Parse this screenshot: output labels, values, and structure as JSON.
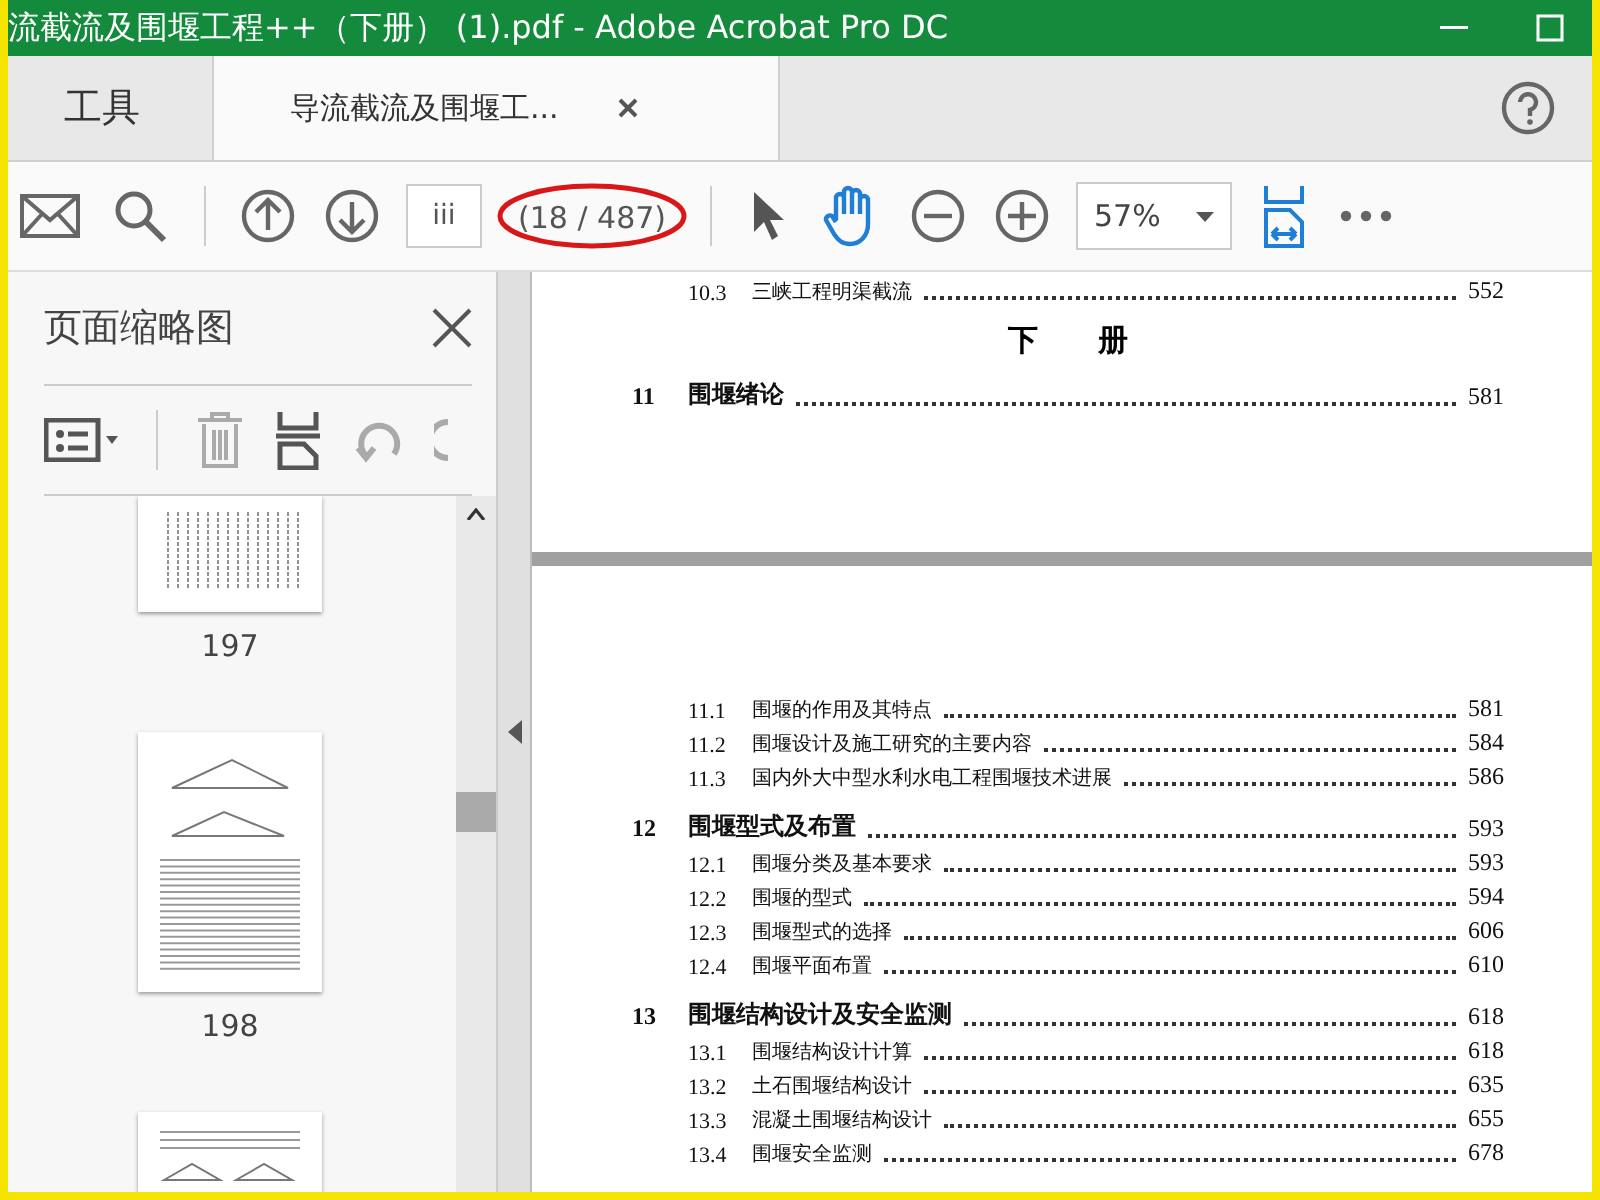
{
  "window": {
    "title": "流截流及围堰工程++（下册） (1).pdf - Adobe Acrobat Pro DC"
  },
  "tabs": [
    {
      "label": "工具",
      "selected": false,
      "closable": false
    },
    {
      "label": "导流截流及围堰工...",
      "selected": true,
      "closable": true
    }
  ],
  "toolbar": {
    "page_field": "iii",
    "page_count": "(18 / 487)",
    "page_count_circled": true,
    "zoom": "57%",
    "tools": [
      {
        "kind": "select",
        "selected": false
      },
      {
        "kind": "hand",
        "selected": true
      }
    ]
  },
  "sidebar": {
    "title": "页面缩略图",
    "thumbnails": [
      {
        "kind": "table",
        "label": "197"
      },
      {
        "kind": "figure",
        "label": "198"
      },
      {
        "kind": "figure-bottom"
      }
    ]
  },
  "document": {
    "pages": [
      {
        "entries": [
          {
            "kind": "section",
            "number": "10.3",
            "title": "三峡工程明渠截流",
            "page": "552"
          },
          {
            "kind": "heading",
            "title": "下　　册"
          },
          {
            "kind": "chapter",
            "number": "11",
            "title": "围堰绪论",
            "page": "581"
          }
        ]
      },
      {
        "entries": [
          {
            "kind": "section",
            "number": "11.1",
            "title": "围堰的作用及其特点",
            "page": "581"
          },
          {
            "kind": "section",
            "number": "11.2",
            "title": "围堰设计及施工研究的主要内容",
            "page": "584"
          },
          {
            "kind": "section",
            "number": "11.3",
            "title": "国内外大中型水利水电工程围堰技术进展",
            "page": "586"
          },
          {
            "kind": "chapter",
            "number": "12",
            "title": "围堰型式及布置",
            "page": "593"
          },
          {
            "kind": "section",
            "number": "12.1",
            "title": "围堰分类及基本要求",
            "page": "593"
          },
          {
            "kind": "section",
            "number": "12.2",
            "title": "围堰的型式",
            "page": "594"
          },
          {
            "kind": "section",
            "number": "12.3",
            "title": "围堰型式的选择",
            "page": "606"
          },
          {
            "kind": "section",
            "number": "12.4",
            "title": "围堰平面布置",
            "page": "610"
          },
          {
            "kind": "chapter",
            "number": "13",
            "title": "围堰结构设计及安全监测",
            "page": "618"
          },
          {
            "kind": "section",
            "number": "13.1",
            "title": "围堰结构设计计算",
            "page": "618"
          },
          {
            "kind": "section",
            "number": "13.2",
            "title": "土石围堰结构设计",
            "page": "635"
          },
          {
            "kind": "section",
            "number": "13.3",
            "title": "混凝土围堰结构设计",
            "page": "655"
          },
          {
            "kind": "section",
            "number": "13.4",
            "title": "围堰安全监测",
            "page": "678"
          }
        ]
      }
    ]
  }
}
